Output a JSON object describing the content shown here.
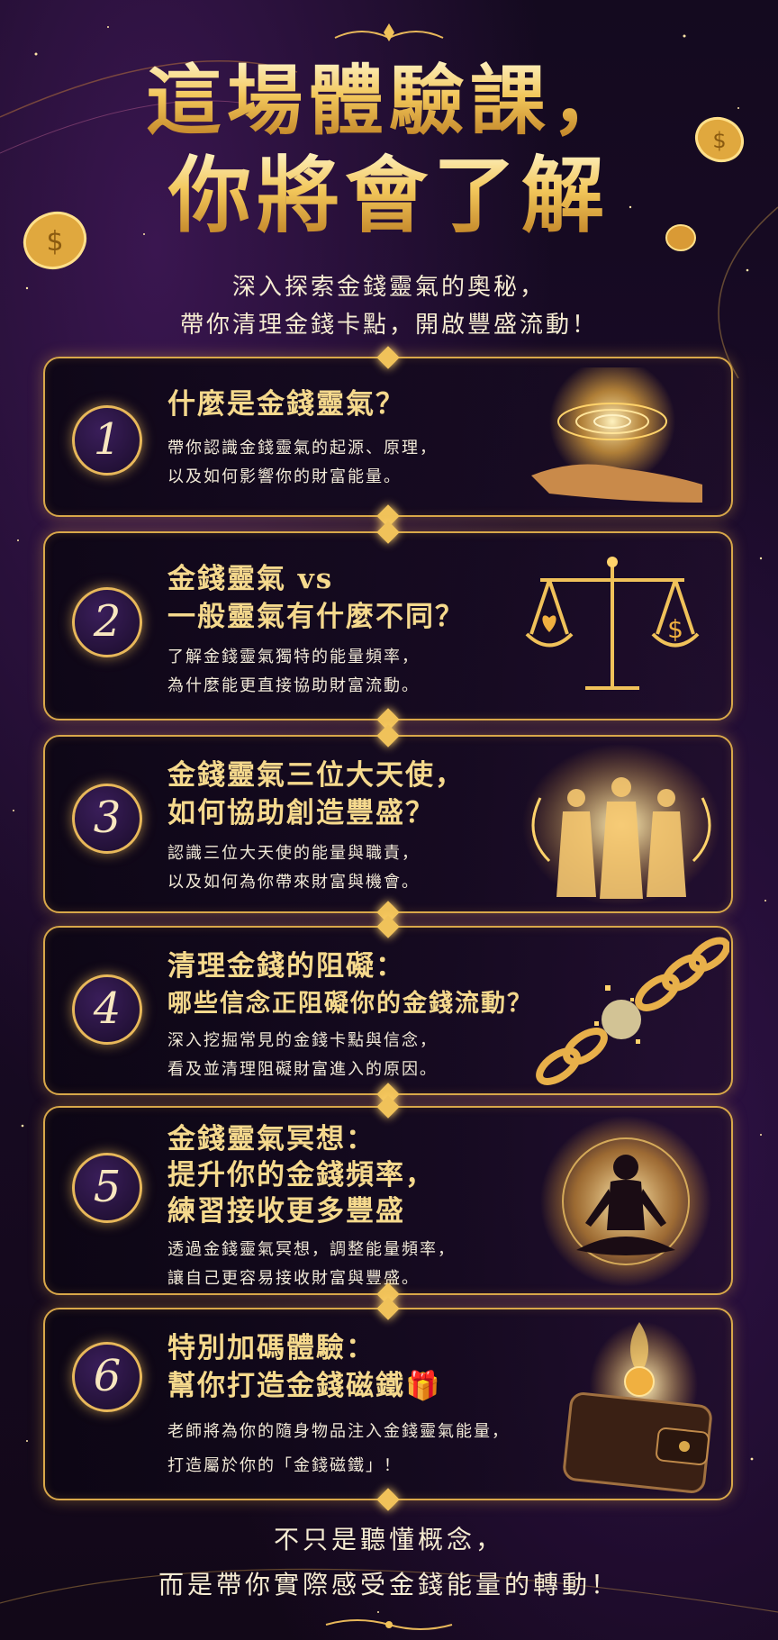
{
  "header": {
    "title_line1": "這場體驗課，",
    "title_line2": "你將會了解",
    "subtitle_line1": "深入探索金錢靈氣的奧秘，",
    "subtitle_line2": "帶你清理金錢卡點，開啟豐盛流動！"
  },
  "cards": [
    {
      "number": "1",
      "title_lines": [
        "什麼是金錢靈氣？"
      ],
      "desc_lines": [
        "帶你認識金錢靈氣的起源、原理，",
        "以及如何影響你的財富能量。"
      ]
    },
    {
      "number": "2",
      "title_lines": [
        "金錢靈氣 vs",
        "一般靈氣有什麼不同？"
      ],
      "desc_lines": [
        "了解金錢靈氣獨特的能量頻率，",
        "為什麼能更直接協助財富流動。"
      ]
    },
    {
      "number": "3",
      "title_lines": [
        "金錢靈氣三位大天使，",
        "如何協助創造豐盛？"
      ],
      "desc_lines": [
        "認識三位大天使的能量與職責，",
        "以及如何為你帶來財富與機會。"
      ]
    },
    {
      "number": "4",
      "title_lines": [
        "清理金錢的阻礙：",
        "哪些信念正阻礙你的金錢流動？"
      ],
      "desc_lines": [
        "深入挖掘常見的金錢卡點與信念，",
        "看及並清理阻礙財富進入的原因。"
      ]
    },
    {
      "number": "5",
      "title_lines": [
        "金錢靈氣冥想：",
        "提升你的金錢頻率，",
        "練習接收更多豐盛"
      ],
      "desc_lines": [
        "透過金錢靈氣冥想，調整能量頻率，",
        "讓自己更容易接收財富與豐盛。"
      ]
    },
    {
      "number": "6",
      "title_lines": [
        "特別加碼體驗：",
        "幫你打造金錢磁鐵🎁"
      ],
      "desc_lines": [
        "老師將為你的隨身物品注入金錢靈氣能量，",
        "打造屬於你的「金錢磁鐵」！"
      ]
    }
  ],
  "footer": {
    "line1": "不只是聽懂概念，",
    "line2": "而是帶你實際感受金錢能量的轉動！"
  },
  "colors": {
    "gold": "#d9a84a",
    "purple": "#2a1240",
    "background": "#140a1f"
  },
  "icons": [
    "energy-spiral-hand-icon",
    "balance-scale-icon",
    "three-angels-icon",
    "broken-chain-icon",
    "meditation-figure-icon",
    "wallet-coin-icon",
    "coin-icon"
  ]
}
